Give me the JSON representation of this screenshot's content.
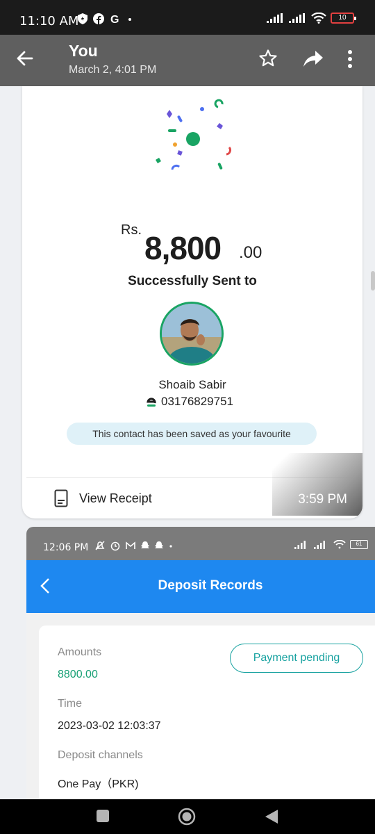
{
  "status_bar": {
    "time": "11:10 AM",
    "left_icons": [
      "shield-icon",
      "facebook-icon",
      "google-icon",
      "dot-icon"
    ],
    "battery": "10"
  },
  "app_bar": {
    "title": "You",
    "subtitle": "March 2, 4:01 PM",
    "icons": [
      "back-arrow-icon",
      "star-icon",
      "share-icon",
      "more-icon"
    ]
  },
  "receipt": {
    "currency": "Rs.",
    "amount": "8,800",
    "cents": ".00",
    "status": "Successfully Sent to",
    "recipient_name": "Shoaib Sabir",
    "recipient_phone": "03176829751",
    "favourite_note": "This contact has been saved as your favourite",
    "view_receipt_label": "View Receipt",
    "timestamp": "3:59 PM"
  },
  "screenshot": {
    "status_time": "12:06 PM",
    "battery": "61",
    "header_title": "Deposit Records",
    "amounts_label": "Amounts",
    "amounts_value": "8800.00",
    "status_badge": "Payment pending",
    "time_label": "Time",
    "time_value": "2023-03-02 12:03:37",
    "channels_label": "Deposit channels",
    "channels_value": "One Pay（PKR)"
  },
  "colors": {
    "success_green": "#19a463",
    "header_blue": "#1e88f0",
    "pending_teal": "#17a2a0",
    "amount_green": "#18a075"
  }
}
